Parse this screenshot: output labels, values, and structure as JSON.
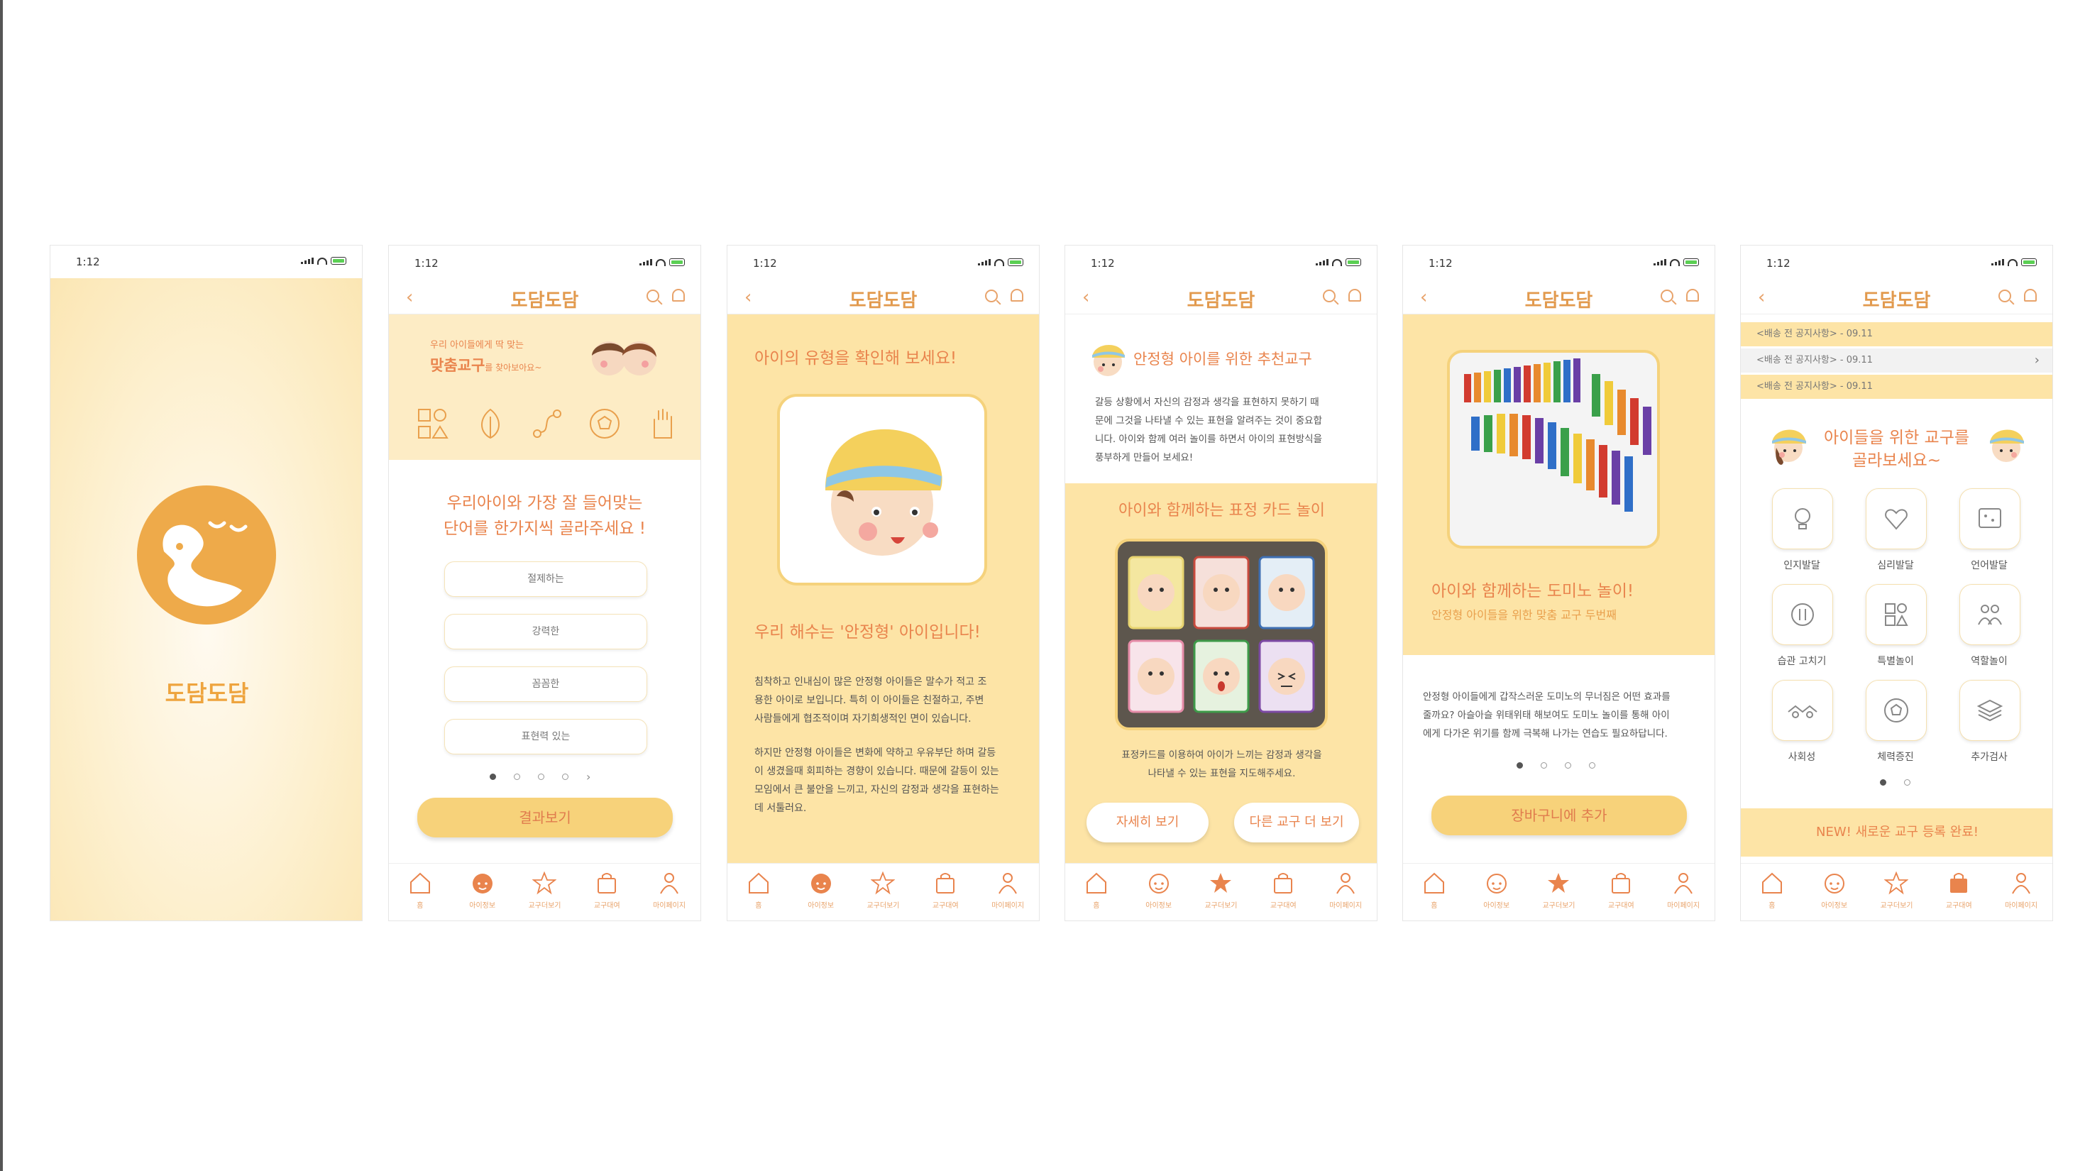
{
  "status": {
    "time": "1:12"
  },
  "app": {
    "name": "도담도담"
  },
  "colors": {
    "accent": "#e9844d",
    "brand": "#eeaa4a",
    "cream": "#fdebc0",
    "button": "#f7d27a"
  },
  "tabs": [
    "홈",
    "아이정보",
    "교구더보기",
    "교구대여",
    "마이페이지"
  ],
  "screen2": {
    "banner_line1": "우리 아이들에게 딱 맞는",
    "banner_bold": "맞춤교구",
    "banner_line2": "를 찾아보아요~",
    "question_line1": "우리아이와 가장 잘 들어맞는",
    "question_line2": "단어를 한가지씩 골라주세요 !",
    "options": [
      "절제하는",
      "강력한",
      "꼼꼼한",
      "표현력 있는"
    ],
    "button": "결과보기"
  },
  "screen3": {
    "heading": "아이의 유형을 확인해 보세요!",
    "result": "우리 해수는 '안정형' 아이입니다!",
    "para1": [
      "침착하고 인내심이 많은 안정형 아이들은 말수가 적고 조",
      "용한 아이로 보입니다. 특히 이 아이들은 친절하고, 주변",
      "사람들에게 협조적이며 자기희생적인 면이 있습니다."
    ],
    "para2": [
      "하지만 안정형 아이들은 변화에 약하고 우유부단 하며 갈등",
      "이 생겼을때 회피하는 경향이 있습니다. 때문에 갈등이 있는",
      "모임에서 큰 불안을 느끼고, 자신의 감정과 생각을 표현하는",
      "데 서툴러요."
    ]
  },
  "screen4": {
    "heading": "안정형 아이를 위한 추천교구",
    "para": [
      "갈등 상황에서 자신의 감정과 생각을 표현하지 못하기 때",
      "문에 그것을 나타낼 수 있는 표현을 알려주는 것이 중요합",
      "니다. 아이와 함께 여러 놀이를 하면서 아이의 표현방식을",
      "풍부하게 만들어 보세요!"
    ],
    "activity": "아이와 함께하는 표정 카드 놀이",
    "caption1": "표정카드를 이용하여 아이가 느끼는 감정과 생각을",
    "caption2": "나타낼 수 있는 표현을 지도해주세요.",
    "detail_button": "자세히 보기",
    "more_button": "다른 교구 더 보기"
  },
  "screen5": {
    "activity": "아이와 함께하는 도미노 놀이!",
    "subtitle": "안정형 아이들을 위한 맞춤 교구 두번째",
    "para": [
      "안정형 아이들에게 갑작스러운 도미노의 무너짐은 어떤 효과를",
      "줄까요? 아슬아슬 위태위태 해보여도 도미노 놀이를 통해 아이",
      "에게 다가온 위기를 함께 극복해 나가는 연습도 필요하답니다."
    ],
    "cart_button": "장바구니에 추가"
  },
  "screen6": {
    "notices": [
      "<배송 전 공지사항> - 09.11",
      "<배송 전 공지사항> - 09.11",
      "<배송 전 공지사항> - 09.11"
    ],
    "heading1": "아이들을 위한 교구를",
    "heading2": "골라보세요~",
    "categories": [
      "인지발달",
      "심리발달",
      "언어발달",
      "습관 고치기",
      "특별놀이",
      "역할놀이",
      "사회성",
      "체력증진",
      "추가검사"
    ],
    "new_banner": "NEW! 새로운 교구 등록 완료!"
  }
}
